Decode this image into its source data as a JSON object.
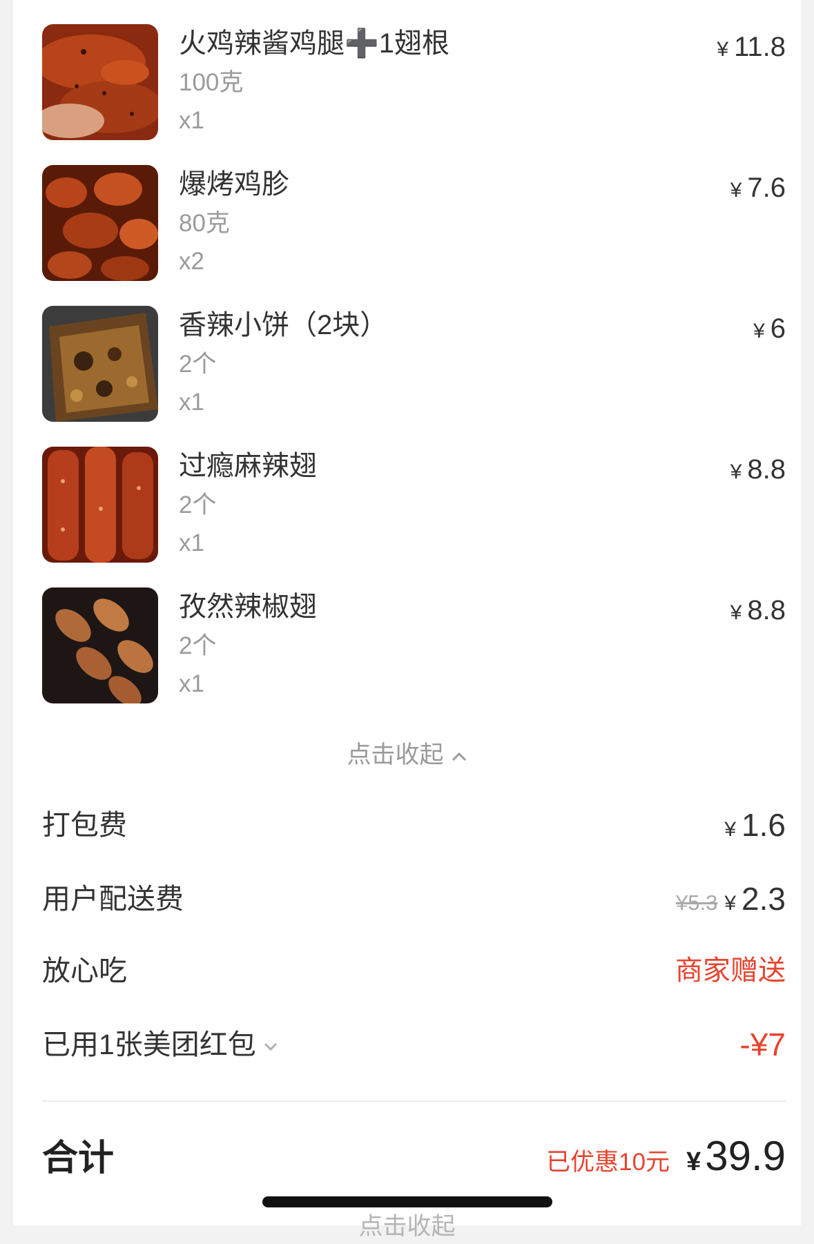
{
  "items": [
    {
      "name": "火鸡辣酱鸡腿➕1翅根",
      "spec": "100克",
      "qty": "x1",
      "currency": "¥",
      "price": "11.8",
      "image_icon": "chicken-leg-photo"
    },
    {
      "name": "爆烤鸡胗",
      "spec": "80克",
      "qty": "x2",
      "currency": "¥",
      "price": "7.6",
      "image_icon": "grilled-gizzard-photo"
    },
    {
      "name": "香辣小饼（2块）",
      "spec": "2个",
      "qty": "x1",
      "currency": "¥",
      "price": "6",
      "image_icon": "spicy-pancake-photo"
    },
    {
      "name": "过瘾麻辣翅",
      "spec": "2个",
      "qty": "x1",
      "currency": "¥",
      "price": "8.8",
      "image_icon": "spicy-wing-photo"
    },
    {
      "name": "孜然辣椒翅",
      "spec": "2个",
      "qty": "x1",
      "currency": "¥",
      "price": "8.8",
      "image_icon": "cumin-wing-photo"
    }
  ],
  "collapse_label": "点击收起",
  "fees": {
    "packing": {
      "label": "打包费",
      "currency": "¥",
      "value": "1.6"
    },
    "delivery": {
      "label": "用户配送费",
      "original": "¥5.3",
      "currency": "¥",
      "value": "2.3"
    },
    "assurance": {
      "label": "放心吃",
      "value": "商家赠送"
    },
    "coupon": {
      "label": "已用1张美团红包",
      "value": "-¥7"
    }
  },
  "total": {
    "label": "合计",
    "saved": "已优惠10元",
    "currency": "¥",
    "amount": "39.9"
  },
  "cut_off_text": "点击收起",
  "colors": {
    "accent_red": "#e8442f",
    "text": "#333333",
    "muted": "#9a9a9a"
  }
}
